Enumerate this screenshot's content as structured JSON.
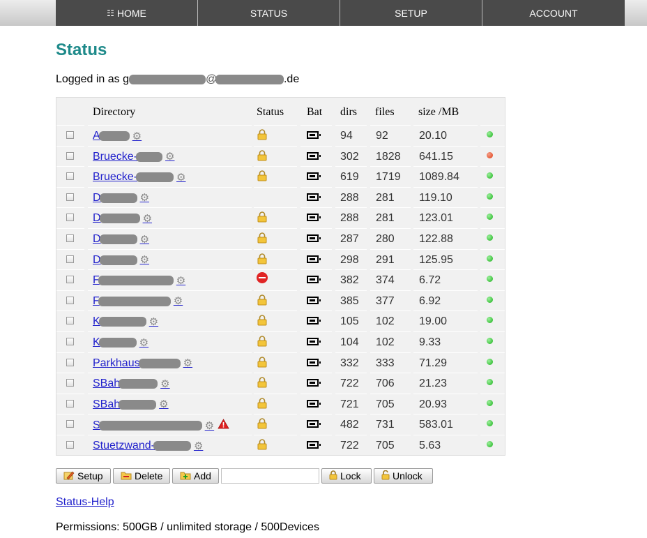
{
  "nav": {
    "items": [
      {
        "label": "HOME",
        "icon": "home-icon"
      },
      {
        "label": "STATUS"
      },
      {
        "label": "SETUP"
      },
      {
        "label": "ACCOUNT"
      }
    ]
  },
  "page": {
    "title": "Status",
    "logged_in_prefix": "Logged in as g",
    "logged_in_suffix": ".de",
    "help_link": "Status-Help",
    "permissions": "Permissions: 500GB / unlimited storage / 500Devices"
  },
  "table": {
    "headers": {
      "directory": "Directory",
      "status": "Status",
      "bat": "Bat",
      "dirs": "dirs",
      "files": "files",
      "size": "size /MB"
    },
    "rows": [
      {
        "name": "A",
        "status": "lock",
        "dirs": "94",
        "files": "92",
        "size": "20.10",
        "state": "green",
        "warn": false
      },
      {
        "name": "Bruecke-",
        "status": "lock",
        "dirs": "302",
        "files": "1828",
        "size": "641.15",
        "state": "red",
        "warn": false
      },
      {
        "name": "Bruecke-",
        "status": "lock",
        "dirs": "619",
        "files": "1719",
        "size": "1089.84",
        "state": "green",
        "warn": false
      },
      {
        "name": "D",
        "status": "",
        "dirs": "288",
        "files": "281",
        "size": "119.10",
        "state": "green",
        "warn": false
      },
      {
        "name": "D",
        "status": "lock",
        "dirs": "288",
        "files": "281",
        "size": "123.01",
        "state": "green",
        "warn": false
      },
      {
        "name": "D",
        "status": "lock",
        "dirs": "287",
        "files": "280",
        "size": "122.88",
        "state": "green",
        "warn": false
      },
      {
        "name": "D",
        "status": "lock",
        "dirs": "298",
        "files": "291",
        "size": "125.95",
        "state": "green",
        "warn": false
      },
      {
        "name": "F",
        "status": "blocked",
        "dirs": "382",
        "files": "374",
        "size": "6.72",
        "state": "green",
        "warn": false
      },
      {
        "name": "F",
        "status": "lock",
        "dirs": "385",
        "files": "377",
        "size": "6.92",
        "state": "green",
        "warn": false
      },
      {
        "name": "K",
        "status": "lock",
        "dirs": "105",
        "files": "102",
        "size": "19.00",
        "state": "green",
        "warn": false
      },
      {
        "name": "K",
        "status": "lock",
        "dirs": "104",
        "files": "102",
        "size": "9.33",
        "state": "green",
        "warn": false
      },
      {
        "name": "Parkhaus",
        "status": "lock",
        "dirs": "332",
        "files": "333",
        "size": "71.29",
        "state": "green",
        "warn": false
      },
      {
        "name": "SBah",
        "status": "lock",
        "dirs": "722",
        "files": "706",
        "size": "21.23",
        "state": "green",
        "warn": false
      },
      {
        "name": "SBah",
        "status": "lock",
        "dirs": "721",
        "files": "705",
        "size": "20.93",
        "state": "green",
        "warn": false
      },
      {
        "name": "S",
        "status": "lock",
        "dirs": "482",
        "files": "731",
        "size": "583.01",
        "state": "green",
        "warn": true
      },
      {
        "name": "Stuetzwand-",
        "status": "lock",
        "dirs": "722",
        "files": "705",
        "size": "5.63",
        "state": "green",
        "warn": false
      }
    ]
  },
  "buttons": {
    "setup": "Setup",
    "delete": "Delete",
    "add": "Add",
    "lock": "Lock",
    "unlock": "Unlock",
    "input_value": ""
  },
  "colors": {
    "title": "#1e8a8a",
    "nav_bg": "#4a4a4a",
    "link": "#2222cc",
    "ok": "#19b019",
    "error": "#e03a10"
  }
}
